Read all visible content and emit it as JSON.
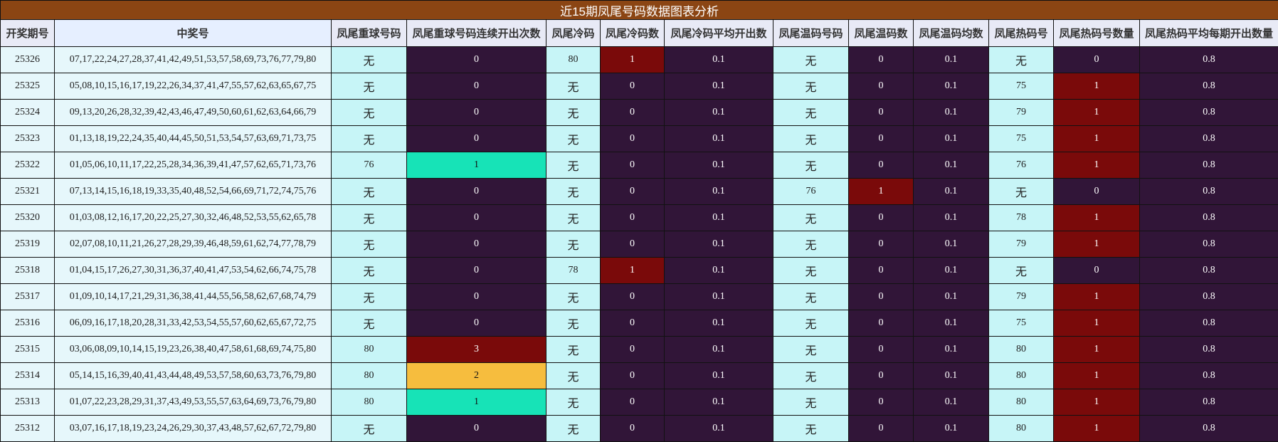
{
  "title": "近15期凤尾号码数据图表分析",
  "headers": [
    "开奖期号",
    "中奖号",
    "凤尾重球号码",
    "凤尾重球号码连续开出次数",
    "凤尾冷码",
    "凤尾冷码数",
    "凤尾冷码平均开出数",
    "凤尾温码号码",
    "凤尾温码数",
    "凤尾温码均数",
    "凤尾热码号",
    "凤尾热码号数量",
    "凤尾热码平均每期开出数量"
  ],
  "colors": {
    "title_bg": "#8B4513",
    "dark_cell": "#311538",
    "red_cell": "#7a0a0a",
    "teal_cell": "#17e3b7",
    "amber_cell": "#f6bd3e",
    "light_cell": "#e6f7fb",
    "cyan_cell": "#c7f5f7"
  },
  "rows": [
    {
      "issue": "25326",
      "numbers": "07,17,22,24,27,28,37,41,42,49,51,53,57,58,69,73,76,77,79,80",
      "repeat": "无",
      "repeat_count": "0",
      "cold": "80",
      "cold_count": "1",
      "cold_avg": "0.1",
      "warm": "无",
      "warm_count": "0",
      "warm_avg": "0.1",
      "hot": "无",
      "hot_count": "0",
      "hot_avg": "0.8"
    },
    {
      "issue": "25325",
      "numbers": "05,08,10,15,16,17,19,22,26,34,37,41,47,55,57,62,63,65,67,75",
      "repeat": "无",
      "repeat_count": "0",
      "cold": "无",
      "cold_count": "0",
      "cold_avg": "0.1",
      "warm": "无",
      "warm_count": "0",
      "warm_avg": "0.1",
      "hot": "75",
      "hot_count": "1",
      "hot_avg": "0.8"
    },
    {
      "issue": "25324",
      "numbers": "09,13,20,26,28,32,39,42,43,46,47,49,50,60,61,62,63,64,66,79",
      "repeat": "无",
      "repeat_count": "0",
      "cold": "无",
      "cold_count": "0",
      "cold_avg": "0.1",
      "warm": "无",
      "warm_count": "0",
      "warm_avg": "0.1",
      "hot": "79",
      "hot_count": "1",
      "hot_avg": "0.8"
    },
    {
      "issue": "25323",
      "numbers": "01,13,18,19,22,24,35,40,44,45,50,51,53,54,57,63,69,71,73,75",
      "repeat": "无",
      "repeat_count": "0",
      "cold": "无",
      "cold_count": "0",
      "cold_avg": "0.1",
      "warm": "无",
      "warm_count": "0",
      "warm_avg": "0.1",
      "hot": "75",
      "hot_count": "1",
      "hot_avg": "0.8"
    },
    {
      "issue": "25322",
      "numbers": "01,05,06,10,11,17,22,25,28,34,36,39,41,47,57,62,65,71,73,76",
      "repeat": "76",
      "repeat_count": "1",
      "cold": "无",
      "cold_count": "0",
      "cold_avg": "0.1",
      "warm": "无",
      "warm_count": "0",
      "warm_avg": "0.1",
      "hot": "76",
      "hot_count": "1",
      "hot_avg": "0.8"
    },
    {
      "issue": "25321",
      "numbers": "07,13,14,15,16,18,19,33,35,40,48,52,54,66,69,71,72,74,75,76",
      "repeat": "无",
      "repeat_count": "0",
      "cold": "无",
      "cold_count": "0",
      "cold_avg": "0.1",
      "warm": "76",
      "warm_count": "1",
      "warm_avg": "0.1",
      "hot": "无",
      "hot_count": "0",
      "hot_avg": "0.8"
    },
    {
      "issue": "25320",
      "numbers": "01,03,08,12,16,17,20,22,25,27,30,32,46,48,52,53,55,62,65,78",
      "repeat": "无",
      "repeat_count": "0",
      "cold": "无",
      "cold_count": "0",
      "cold_avg": "0.1",
      "warm": "无",
      "warm_count": "0",
      "warm_avg": "0.1",
      "hot": "78",
      "hot_count": "1",
      "hot_avg": "0.8"
    },
    {
      "issue": "25319",
      "numbers": "02,07,08,10,11,21,26,27,28,29,39,46,48,59,61,62,74,77,78,79",
      "repeat": "无",
      "repeat_count": "0",
      "cold": "无",
      "cold_count": "0",
      "cold_avg": "0.1",
      "warm": "无",
      "warm_count": "0",
      "warm_avg": "0.1",
      "hot": "79",
      "hot_count": "1",
      "hot_avg": "0.8"
    },
    {
      "issue": "25318",
      "numbers": "01,04,15,17,26,27,30,31,36,37,40,41,47,53,54,62,66,74,75,78",
      "repeat": "无",
      "repeat_count": "0",
      "cold": "78",
      "cold_count": "1",
      "cold_avg": "0.1",
      "warm": "无",
      "warm_count": "0",
      "warm_avg": "0.1",
      "hot": "无",
      "hot_count": "0",
      "hot_avg": "0.8"
    },
    {
      "issue": "25317",
      "numbers": "01,09,10,14,17,21,29,31,36,38,41,44,55,56,58,62,67,68,74,79",
      "repeat": "无",
      "repeat_count": "0",
      "cold": "无",
      "cold_count": "0",
      "cold_avg": "0.1",
      "warm": "无",
      "warm_count": "0",
      "warm_avg": "0.1",
      "hot": "79",
      "hot_count": "1",
      "hot_avg": "0.8"
    },
    {
      "issue": "25316",
      "numbers": "06,09,16,17,18,20,28,31,33,42,53,54,55,57,60,62,65,67,72,75",
      "repeat": "无",
      "repeat_count": "0",
      "cold": "无",
      "cold_count": "0",
      "cold_avg": "0.1",
      "warm": "无",
      "warm_count": "0",
      "warm_avg": "0.1",
      "hot": "75",
      "hot_count": "1",
      "hot_avg": "0.8"
    },
    {
      "issue": "25315",
      "numbers": "03,06,08,09,10,14,15,19,23,26,38,40,47,58,61,68,69,74,75,80",
      "repeat": "80",
      "repeat_count": "3",
      "cold": "无",
      "cold_count": "0",
      "cold_avg": "0.1",
      "warm": "无",
      "warm_count": "0",
      "warm_avg": "0.1",
      "hot": "80",
      "hot_count": "1",
      "hot_avg": "0.8"
    },
    {
      "issue": "25314",
      "numbers": "05,14,15,16,39,40,41,43,44,48,49,53,57,58,60,63,73,76,79,80",
      "repeat": "80",
      "repeat_count": "2",
      "cold": "无",
      "cold_count": "0",
      "cold_avg": "0.1",
      "warm": "无",
      "warm_count": "0",
      "warm_avg": "0.1",
      "hot": "80",
      "hot_count": "1",
      "hot_avg": "0.8"
    },
    {
      "issue": "25313",
      "numbers": "01,07,22,23,28,29,31,37,43,49,53,55,57,63,64,69,73,76,79,80",
      "repeat": "80",
      "repeat_count": "1",
      "cold": "无",
      "cold_count": "0",
      "cold_avg": "0.1",
      "warm": "无",
      "warm_count": "0",
      "warm_avg": "0.1",
      "hot": "80",
      "hot_count": "1",
      "hot_avg": "0.8"
    },
    {
      "issue": "25312",
      "numbers": "03,07,16,17,18,19,23,24,26,29,30,37,43,48,57,62,67,72,79,80",
      "repeat": "无",
      "repeat_count": "0",
      "cold": "无",
      "cold_count": "0",
      "cold_avg": "0.1",
      "warm": "无",
      "warm_count": "0",
      "warm_avg": "0.1",
      "hot": "80",
      "hot_count": "1",
      "hot_avg": "0.8"
    }
  ]
}
